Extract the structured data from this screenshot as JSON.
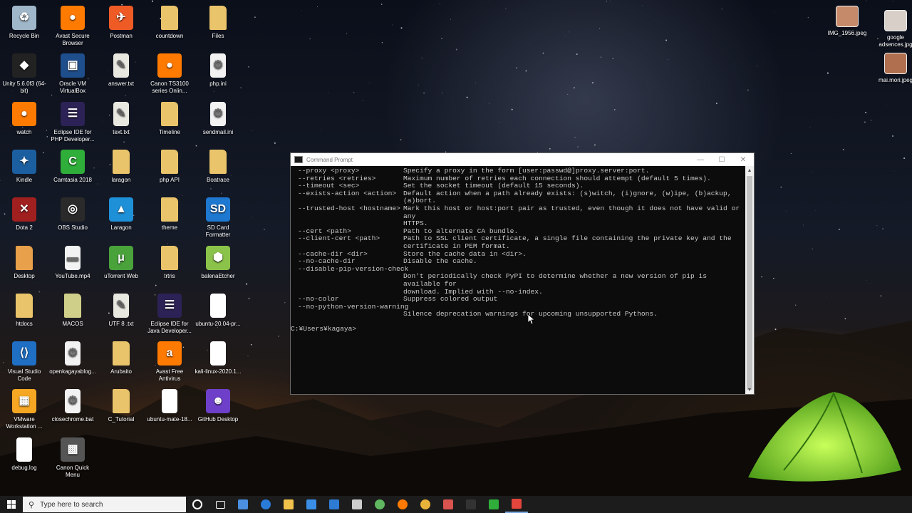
{
  "desktop": {
    "icons": [
      {
        "label": "Recycle Bin",
        "icon": "recycle-bin-icon",
        "color": "#9fb7c9",
        "glyph": "♻"
      },
      {
        "label": "Avast Secure Browser",
        "icon": "avast-browser-icon",
        "color": "#ff7a00",
        "glyph": "●"
      },
      {
        "label": "Postman",
        "icon": "postman-icon",
        "color": "#ef5b25",
        "glyph": "✈"
      },
      {
        "label": "countdown",
        "icon": "folder-icon",
        "color": "#e9c46a",
        "glyph": ""
      },
      {
        "label": "Files",
        "icon": "folder-icon",
        "color": "#e9c46a",
        "glyph": ""
      },
      {
        "label": "Unity 5.6.0f3 (64-bit)",
        "icon": "unity-icon",
        "color": "#222222",
        "glyph": "◆"
      },
      {
        "label": "Oracle VM VirtualBox",
        "icon": "virtualbox-icon",
        "color": "#1f4e8c",
        "glyph": "▣"
      },
      {
        "label": "answer.txt",
        "icon": "text-file-icon",
        "color": "#e8e8e0",
        "glyph": "✎"
      },
      {
        "label": "Canon TS3100 series Onlin...",
        "icon": "avast-browser-icon",
        "color": "#ff7a00",
        "glyph": "●"
      },
      {
        "label": "php.ini",
        "icon": "config-file-icon",
        "color": "#f2f2f2",
        "glyph": "⚙"
      },
      {
        "label": "watch",
        "icon": "avast-browser-icon",
        "color": "#ff7a00",
        "glyph": "●"
      },
      {
        "label": "Eclipse IDE for PHP Developer...",
        "icon": "eclipse-icon",
        "color": "#2c2255",
        "glyph": "☰"
      },
      {
        "label": "text.txt",
        "icon": "text-file-icon",
        "color": "#e8e8e0",
        "glyph": "✎"
      },
      {
        "label": "Timeline",
        "icon": "folder-icon",
        "color": "#e9c46a",
        "glyph": ""
      },
      {
        "label": "sendmail.ini",
        "icon": "config-file-icon",
        "color": "#f2f2f2",
        "glyph": "⚙"
      },
      {
        "label": "Kindle",
        "icon": "kindle-icon",
        "color": "#1b5fa0",
        "glyph": "✦"
      },
      {
        "label": "Camtasia 2018",
        "icon": "camtasia-icon",
        "color": "#2fae3a",
        "glyph": "C"
      },
      {
        "label": "laragon",
        "icon": "file-icon",
        "color": "#e9c46a",
        "glyph": ""
      },
      {
        "label": "php API",
        "icon": "folder-icon",
        "color": "#e9c46a",
        "glyph": ""
      },
      {
        "label": "Boatrace",
        "icon": "folder-icon",
        "color": "#e9c46a",
        "glyph": ""
      },
      {
        "label": "Dota 2",
        "icon": "dota-icon",
        "color": "#a01f1f",
        "glyph": "✕"
      },
      {
        "label": "OBS Studio",
        "icon": "obs-icon",
        "color": "#2a2a2a",
        "glyph": "◎"
      },
      {
        "label": "Laragon",
        "icon": "laragon-icon",
        "color": "#1e90d8",
        "glyph": "▲"
      },
      {
        "label": "theme",
        "icon": "folder-icon",
        "color": "#e9c46a",
        "glyph": ""
      },
      {
        "label": "SD Card Formatter",
        "icon": "sd-card-icon",
        "color": "#1e78d0",
        "glyph": "SD"
      },
      {
        "label": "Desktop",
        "icon": "folder-icon",
        "color": "#e9a04a",
        "glyph": ""
      },
      {
        "label": "YouTube.mp4",
        "icon": "video-file-icon",
        "color": "#f2f2f2",
        "glyph": "▬"
      },
      {
        "label": "uTorrent Web",
        "icon": "utorrent-icon",
        "color": "#4aa23b",
        "glyph": "μ"
      },
      {
        "label": "trtris",
        "icon": "folder-icon",
        "color": "#e9c46a",
        "glyph": ""
      },
      {
        "label": "balenaEtcher",
        "icon": "balena-icon",
        "color": "#8bc34a",
        "glyph": "⬢"
      },
      {
        "label": "htdocs",
        "icon": "folder-icon",
        "color": "#e9c46a",
        "glyph": ""
      },
      {
        "label": "MACOS",
        "icon": "folder-icon",
        "color": "#cfcf8a",
        "glyph": ""
      },
      {
        "label": "UTF 8 .txt",
        "icon": "text-file-icon",
        "color": "#e8e8e0",
        "glyph": "✎"
      },
      {
        "label": "Eclipse IDE for Java Developer...",
        "icon": "eclipse-icon",
        "color": "#2c2255",
        "glyph": "☰"
      },
      {
        "label": "ubuntu-20.04-pr...",
        "icon": "blank-file-icon",
        "color": "#ffffff",
        "glyph": ""
      },
      {
        "label": "Visual Studio Code",
        "icon": "vscode-icon",
        "color": "#1f6fc4",
        "glyph": "⟨⟩"
      },
      {
        "label": "openkagayablog...",
        "icon": "config-file-icon",
        "color": "#f2f2f2",
        "glyph": "⚙"
      },
      {
        "label": "Arubaito",
        "icon": "file-icon",
        "color": "#e9c46a",
        "glyph": ""
      },
      {
        "label": "Avast Free Antivirus",
        "icon": "avast-icon",
        "color": "#ff7a00",
        "glyph": "a"
      },
      {
        "label": "kali-linux-2020.1...",
        "icon": "blank-file-icon",
        "color": "#ffffff",
        "glyph": ""
      },
      {
        "label": "VMware Workstation ...",
        "icon": "vmware-icon",
        "color": "#f5a623",
        "glyph": "▦"
      },
      {
        "label": "closechrome.bat",
        "icon": "config-file-icon",
        "color": "#f2f2f2",
        "glyph": "⚙"
      },
      {
        "label": "C_Tutorial",
        "icon": "folder-icon",
        "color": "#e9c46a",
        "glyph": ""
      },
      {
        "label": "ubuntu-mate-18...",
        "icon": "blank-file-icon",
        "color": "#ffffff",
        "glyph": ""
      },
      {
        "label": "GitHub Desktop",
        "icon": "github-icon",
        "color": "#6e40c9",
        "glyph": "☻"
      },
      {
        "label": "debug.log",
        "icon": "blank-file-icon",
        "color": "#ffffff",
        "glyph": ""
      },
      {
        "label": "Canon Quick Menu",
        "icon": "canon-icon",
        "color": "#555555",
        "glyph": "▩"
      }
    ],
    "right_icons": [
      {
        "label": "IMG_1956.jpeg",
        "icon": "image-file-icon",
        "color": "#c48a6a"
      },
      {
        "label": "google adsences.jpg",
        "icon": "image-file-icon",
        "color": "#d8d0c8"
      },
      {
        "label": "mai.mori.jpeg",
        "icon": "image-file-icon",
        "color": "#b07050"
      }
    ]
  },
  "cmd": {
    "title": "Command Prompt",
    "options": [
      {
        "name": "--proxy <proxy>",
        "desc": "Specify a proxy in the form [user:passwd@]proxy.server:port."
      },
      {
        "name": "--retries <retries>",
        "desc": "Maximum number of retries each connection should attempt (default 5 times)."
      },
      {
        "name": "--timeout <sec>",
        "desc": "Set the socket timeout (default 15 seconds)."
      },
      {
        "name": "--exists-action <action>",
        "desc": "Default action when a path already exists: (s)witch, (i)gnore, (w)ipe, (b)ackup,\n(a)bort."
      },
      {
        "name": "--trusted-host <hostname>",
        "desc": "Mark this host or host:port pair as trusted, even though it does not have valid or any\nHTTPS."
      },
      {
        "name": "--cert <path>",
        "desc": "Path to alternate CA bundle."
      },
      {
        "name": "--client-cert <path>",
        "desc": "Path to SSL client certificate, a single file containing the private key and the\ncertificate in PEM format."
      },
      {
        "name": "--cache-dir <dir>",
        "desc": "Store the cache data in <dir>."
      },
      {
        "name": "--no-cache-dir",
        "desc": "Disable the cache."
      },
      {
        "name": "--disable-pip-version-check",
        "desc": "\nDon't periodically check PyPI to determine whether a new version of pip is available for\ndownload. Implied with --no-index."
      },
      {
        "name": "--no-color",
        "desc": "Suppress colored output"
      },
      {
        "name": "--no-python-version-warning",
        "desc": "\nSilence deprecation warnings for upcoming unsupported Pythons."
      }
    ],
    "prompt": "C:¥Users¥kagaya>"
  },
  "taskbar": {
    "search_placeholder": "Type here to search",
    "icons": [
      {
        "name": "cortana-icon",
        "color": "#ffffff"
      },
      {
        "name": "task-view-icon",
        "color": "#ffffff"
      },
      {
        "name": "network-app-icon",
        "color": "#4a8fe0"
      },
      {
        "name": "edge-icon",
        "color": "#2a7ad8"
      },
      {
        "name": "file-explorer-icon",
        "color": "#f0c14b"
      },
      {
        "name": "store-icon",
        "color": "#3a8ee6"
      },
      {
        "name": "mail-icon",
        "color": "#2e7bd6"
      },
      {
        "name": "snipping-tool-icon",
        "color": "#cccccc"
      },
      {
        "name": "android-studio-icon",
        "color": "#5fb85f"
      },
      {
        "name": "avast-browser-taskbar-icon",
        "color": "#ff7a00"
      },
      {
        "name": "chrome-icon",
        "color": "#e8b33a"
      },
      {
        "name": "tiles-app-icon",
        "color": "#d9534f"
      },
      {
        "name": "command-prompt-taskbar-icon",
        "color": "#333333"
      },
      {
        "name": "camtasia-taskbar-icon",
        "color": "#2fae3a"
      },
      {
        "name": "camtasia-recorder-taskbar-icon",
        "color": "#e2453c"
      }
    ]
  }
}
